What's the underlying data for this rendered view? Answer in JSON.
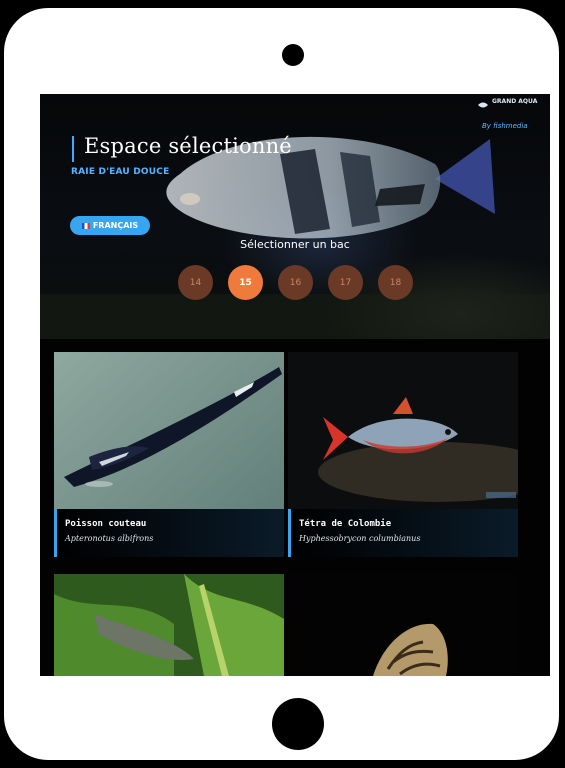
{
  "header": {
    "title": "Espace sélectionné",
    "subtitle": "RAIE D'EAU DOUCE",
    "logo_top": "GRAND AQUA",
    "logo_bottom": "By fishmedia"
  },
  "language_button": {
    "label": "FRANÇAIS"
  },
  "tank_selector": {
    "label": "Sélectionner un bac",
    "tanks": [
      "14",
      "15",
      "16",
      "17",
      "18"
    ],
    "active": "15"
  },
  "species": [
    {
      "name": "Poisson couteau",
      "scientific": "Apteronotus albifrons"
    },
    {
      "name": "Tétra de Colombie",
      "scientific": "Hyphessobrycon columbianus"
    }
  ],
  "colors": {
    "accent": "#3aa5ef",
    "active_tank": "#ef7a3c",
    "inactive_tank": "#6b3a26"
  }
}
